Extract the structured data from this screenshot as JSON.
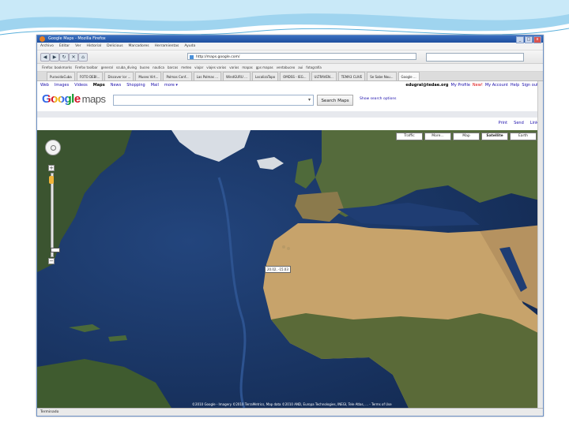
{
  "window": {
    "title": "Google Maps - Mozilla Firefox",
    "controls": {
      "minimize": "_",
      "maximize": "□",
      "close": "x"
    }
  },
  "menubar": [
    "Archivo",
    "Editar",
    "Ver",
    "Historial",
    "Delicious",
    "Marcadores",
    "Herramientas",
    "Ayuda"
  ],
  "navbar": {
    "back": "◀",
    "forward": "▶",
    "reload": "↻",
    "stop": "✕",
    "home": "⌂",
    "url": "http://maps.google.com/"
  },
  "bookmarks": [
    "Firefox: bookmarks",
    "Firefox toolbar",
    "general",
    "scuba_diving",
    "buceo",
    "nautica",
    "barcos",
    "meteo",
    "viajar",
    "viajes varios",
    "varios",
    "mapas",
    "gps mapas",
    "ventabuceo",
    "aui",
    "fotografía"
  ],
  "tabs": [
    {
      "label": "PuravidaCuba",
      "active": false
    },
    {
      "label": "FOTO DEBI...",
      "active": false
    },
    {
      "label": "Discover lor ...",
      "active": false
    },
    {
      "label": "Museo Virt...",
      "active": false
    },
    {
      "label": "Palmas Conf...",
      "active": false
    },
    {
      "label": "Las Palmas ...",
      "active": false
    },
    {
      "label": "WindGURU ...",
      "active": false
    },
    {
      "label": "LocalizaTopo",
      "active": false
    },
    {
      "label": "OMDSS - IEG...",
      "active": false
    },
    {
      "label": "ULTRAVEN...",
      "active": false
    },
    {
      "label": "TEMA3 CLIVE",
      "active": false
    },
    {
      "label": "Se Sabe Nou...",
      "active": false
    },
    {
      "label": "Google ...",
      "active": true
    }
  ],
  "google_nav": {
    "links": [
      "Web",
      "Images",
      "Videos",
      "Maps",
      "News",
      "Shopping",
      "Mail",
      "more ▾"
    ],
    "active": "Maps",
    "email": "edugral@tedae.org",
    "account_links": [
      "My Profile",
      "New!",
      "My Account",
      "Help",
      "Sign out"
    ]
  },
  "search": {
    "logo_google": "Google",
    "logo_maps": "maps",
    "button": "Search Maps",
    "options_link": "Show search options",
    "dropdown": "▾"
  },
  "map_actions": [
    "Print",
    "Send",
    "Link"
  ],
  "map_types": [
    {
      "label": "Traffic",
      "active": false
    },
    {
      "label": "More...",
      "active": false
    },
    {
      "label": "Map",
      "active": false
    },
    {
      "label": "Satellite",
      "active": true
    },
    {
      "label": "Earth",
      "active": false
    }
  ],
  "zoom": {
    "plus": "+",
    "minus": "−",
    "level_fraction": 0.9
  },
  "map_labels": {
    "coordinate_tip": "20.02, -15.03",
    "attribution": "©2010 Google - Imagery ©2010 TerraMetrics, Map data ©2010 AND, Europa Technologies, INEGI, Tele Atlas, ... - Terms of Use"
  },
  "statusbar": "Terminado",
  "colors": {
    "ocean": "#1d3a6b",
    "desert": "#c7a36b",
    "land_green": "#3f5b2f",
    "titlebar": "#2a5fb0"
  }
}
